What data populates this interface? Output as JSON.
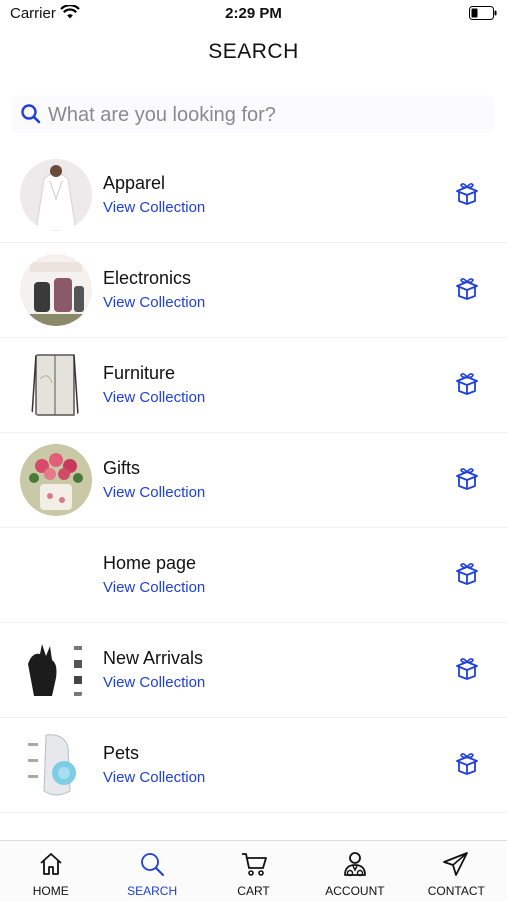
{
  "status_bar": {
    "carrier": "Carrier",
    "time": "2:29 PM"
  },
  "header": {
    "title": "SEARCH"
  },
  "search": {
    "placeholder": "What are you looking for?"
  },
  "collections": [
    {
      "name": "Apparel",
      "link": "View Collection",
      "image": "apparel-photo"
    },
    {
      "name": "Electronics",
      "link": "View Collection",
      "image": "electronics-photo"
    },
    {
      "name": "Furniture",
      "link": "View Collection",
      "image": "furniture-photo"
    },
    {
      "name": "Gifts",
      "link": "View Collection",
      "image": "gifts-photo"
    },
    {
      "name": "Home page",
      "link": "View Collection",
      "image": ""
    },
    {
      "name": "New Arrivals",
      "link": "View Collection",
      "image": "new-arrivals-photo"
    },
    {
      "name": "Pets",
      "link": "View Collection",
      "image": "pets-photo"
    }
  ],
  "tabs": [
    {
      "label": "HOME",
      "icon": "home-icon"
    },
    {
      "label": "SEARCH",
      "icon": "search-icon",
      "active": true
    },
    {
      "label": "CART",
      "icon": "cart-icon"
    },
    {
      "label": "ACCOUNT",
      "icon": "account-icon"
    },
    {
      "label": "CONTACT",
      "icon": "send-icon"
    }
  ],
  "colors": {
    "accent": "#1e3fd8",
    "text": "#111111",
    "placeholder": "#8a8a8e"
  }
}
